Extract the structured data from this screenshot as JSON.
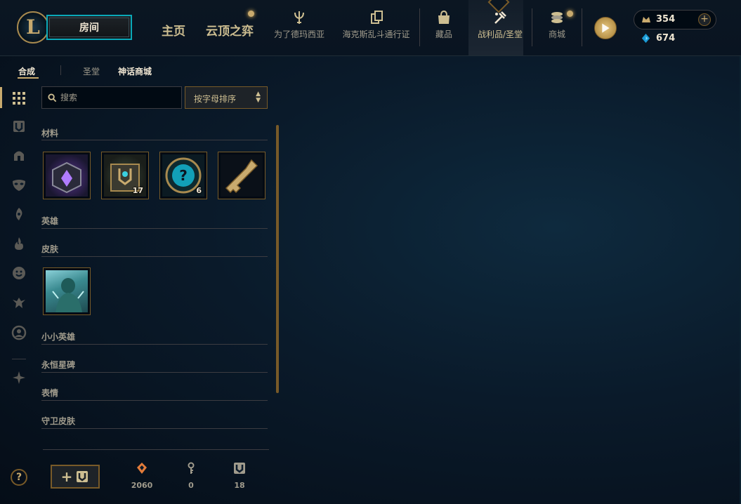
{
  "topbar": {
    "logo_text": "L",
    "play_button_label": "房间",
    "nav_main": [
      {
        "label": "主页"
      },
      {
        "label": "云顶之弈"
      }
    ],
    "nav_icons": [
      {
        "label": "为了德玛西亚",
        "icon": "trident-icon"
      },
      {
        "label": "海克斯乱斗通行证",
        "icon": "cards-icon"
      },
      {
        "label": "藏品",
        "icon": "bag-icon"
      },
      {
        "label": "战利品/圣堂",
        "icon": "hammer-icon"
      },
      {
        "label": "商城",
        "icon": "coins-icon"
      }
    ],
    "currency": {
      "blue_essence": "354",
      "orange_essence": "674"
    },
    "add_label": "+"
  },
  "subtabs": [
    {
      "label": "合成"
    },
    {
      "label": "圣堂"
    },
    {
      "label": "神话商城"
    }
  ],
  "rail_icons": [
    "grid-icon",
    "chest-icon",
    "helmet-icon",
    "mask-icon",
    "ward-icon",
    "flame-icon",
    "emote-icon",
    "sentinel-icon",
    "avatar-icon",
    "misc-icon"
  ],
  "search": {
    "placeholder": "搜索",
    "value": ""
  },
  "sort": {
    "value": "按字母排序"
  },
  "categories": [
    {
      "title": "材料"
    },
    {
      "title": "英雄"
    },
    {
      "title": "皮肤"
    },
    {
      "title": "小小英雄"
    },
    {
      "title": "永恒星碑"
    },
    {
      "title": "表情"
    },
    {
      "title": "守卫皮肤"
    }
  ],
  "materials": [
    {
      "name": "mythic-chest-icon",
      "count": ""
    },
    {
      "name": "hextech-chest-icon",
      "count": "17"
    },
    {
      "name": "mystery-orb-icon",
      "count": "6"
    },
    {
      "name": "hextech-key-icon",
      "count": ""
    }
  ],
  "skins": [
    {
      "name": "skin-portrait",
      "count": ""
    }
  ],
  "bottom": {
    "craft_label": "+",
    "resources": [
      {
        "icon": "orange-essence-icon",
        "value": "2060"
      },
      {
        "icon": "key-fragment-icon",
        "value": "0"
      },
      {
        "icon": "chest-icon",
        "value": "18"
      }
    ]
  },
  "help_label": "?",
  "colors": {
    "gold": "#c8aa6e",
    "teal": "#0aa8b8",
    "dark_gold": "#785a28",
    "bg": "#0a1a2a"
  }
}
